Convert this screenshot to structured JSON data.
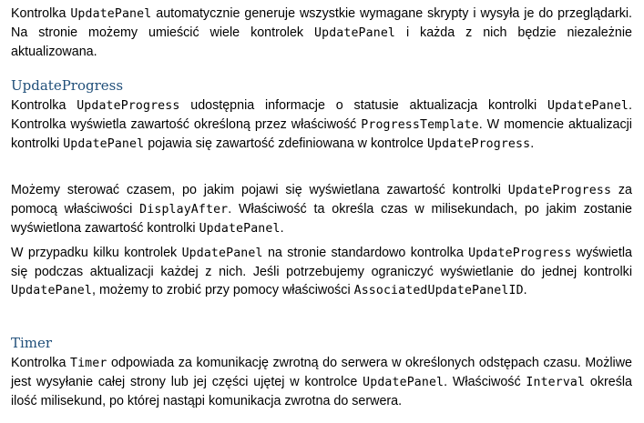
{
  "p1": {
    "t1": "Kontrolka ",
    "c1": "UpdatePanel",
    "t2": " automatycznie generuje wszystkie wymagane skrypty i wysyła je do przeglądarki. Na stronie możemy umieścić wiele kontrolek ",
    "c2": "UpdatePanel",
    "t3": " i każda z nich będzie niezależnie aktualizowana."
  },
  "h_progress": "UpdateProgress",
  "p2": {
    "t1": "Kontrolka ",
    "c1": "UpdateProgress",
    "t2": " udostępnia informacje o statusie aktualizacja kontrolki ",
    "c2": "UpdatePanel",
    "t3": ". Kontrolka wyświetla zawartość określoną przez właściwość ",
    "c3": "ProgressTemplate",
    "t4": ". W momencie aktualizacji kontrolki ",
    "c4": "UpdatePanel",
    "t5": " pojawia się zawartość zdefiniowana w kontrolce ",
    "c5": "UpdateProgress",
    "t6": "."
  },
  "p3": {
    "t1": "Możemy sterować czasem, po jakim pojawi się wyświetlana zawartość kontrolki ",
    "c1": "UpdateProgress",
    "t2": " za pomocą właściwości ",
    "c2": "DisplayAfter",
    "t3": ". Właściwość ta określa czas w milisekundach, po jakim zostanie wyświetlona zawartość kontrolki ",
    "c3": "UpdatePanel",
    "t4": "."
  },
  "p4": {
    "t1": "W przypadku kilku kontrolek ",
    "c1": "UpdatePanel",
    "t2": " na stronie standardowo kontrolka ",
    "c2": "UpdateProgress",
    "t3": " wyświetla się podczas aktualizacji każdej z nich. Jeśli potrzebujemy ograniczyć wyświetlanie do jednej kontrolki ",
    "c3": "UpdatePanel",
    "t4": ", możemy to zrobić przy pomocy właściwości ",
    "c4": "AssociatedUpdatePanelID",
    "t5": "."
  },
  "h_timer": "Timer",
  "p5": {
    "t1": "Kontrolka ",
    "c1": "Timer",
    "t2": " odpowiada za komunikację zwrotną do serwera w określonych odstępach czasu. Możliwe jest wysyłanie całej strony lub jej części ujętej w kontrolce ",
    "c2": "UpdatePanel",
    "t3": ". Właściwość ",
    "c3": "Interval",
    "t4": " określa ilość milisekund, po której nastąpi komunikacja zwrotna do serwera."
  }
}
